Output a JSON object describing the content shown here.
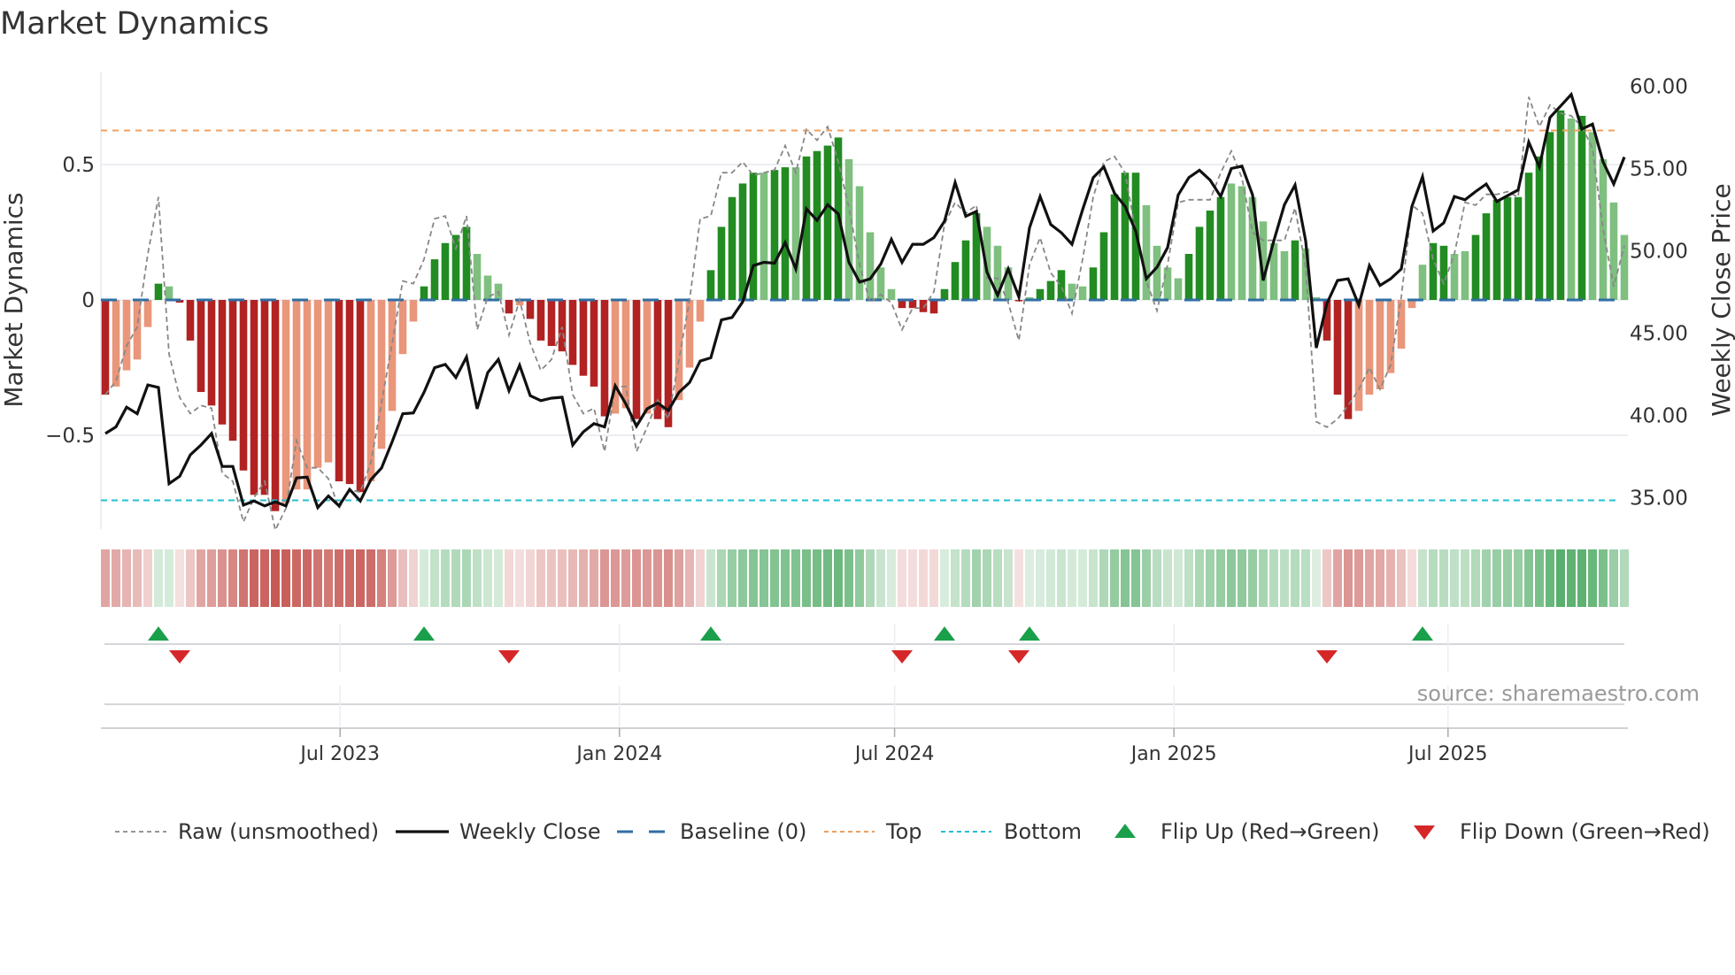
{
  "chart_data": {
    "type": "bar",
    "title": "Market Dynamics",
    "ylabel": "Market Dynamics",
    "y2label": "Weekly Close Price",
    "source": "source: sharemaestro.com",
    "ylim": [
      -0.846,
      0.843
    ],
    "y2lim": [
      33.07,
      60.9
    ],
    "left_ticks": [
      {
        "value": 0.5,
        "label": "0.5"
      },
      {
        "value": 0,
        "label": "0"
      },
      {
        "value": -0.5,
        "label": "−0.5"
      }
    ],
    "right_ticks": [
      {
        "value": 60,
        "label": "60.00"
      },
      {
        "value": 55,
        "label": "55.00"
      },
      {
        "value": 50,
        "label": "50.00"
      },
      {
        "value": 45,
        "label": "45.00"
      },
      {
        "value": 40,
        "label": "40.00"
      },
      {
        "value": 35,
        "label": "35.00"
      }
    ],
    "x_ticks": [
      {
        "week": 22.1,
        "label": "Jul 2023"
      },
      {
        "week": 48.4,
        "label": "Jan 2024"
      },
      {
        "week": 74.3,
        "label": "Jul 2024"
      },
      {
        "week": 100.6,
        "label": "Jan 2025"
      },
      {
        "week": 126.4,
        "label": "Jul 2025"
      }
    ],
    "levels": {
      "baseline": 0,
      "top": 0.626,
      "bottom": -0.74
    },
    "colors": {
      "strong_green": "#228b22",
      "weak_green": "#7fbf7f",
      "strong_red": "#b22222",
      "weak_red": "#e9967a",
      "close": "#111111",
      "raw": "#888888",
      "baseline": "#2f6fa3",
      "top": "#f0a060",
      "bottom": "#22c0d0",
      "flip_up": "#1a9f4a",
      "flip_down": "#d62728",
      "heat_green": "#4aa860",
      "heat_red": "#c75a55"
    },
    "smoothed": [
      -0.35,
      -0.32,
      -0.26,
      -0.22,
      -0.1,
      0.06,
      0.05,
      -0.01,
      -0.15,
      -0.34,
      -0.39,
      -0.46,
      -0.52,
      -0.63,
      -0.72,
      -0.72,
      -0.78,
      -0.75,
      -0.7,
      -0.7,
      -0.62,
      -0.6,
      -0.67,
      -0.68,
      -0.71,
      -0.67,
      -0.55,
      -0.41,
      -0.2,
      -0.08,
      0.05,
      0.15,
      0.21,
      0.24,
      0.27,
      0.17,
      0.09,
      0.06,
      -0.05,
      -0.02,
      -0.07,
      -0.15,
      -0.17,
      -0.19,
      -0.24,
      -0.28,
      -0.32,
      -0.43,
      -0.42,
      -0.4,
      -0.44,
      -0.42,
      -0.44,
      -0.47,
      -0.37,
      -0.25,
      -0.08,
      0.11,
      0.27,
      0.38,
      0.43,
      0.47,
      0.47,
      0.48,
      0.49,
      0.49,
      0.53,
      0.55,
      0.57,
      0.6,
      0.52,
      0.42,
      0.25,
      0.12,
      0.04,
      -0.03,
      -0.03,
      -0.045,
      -0.05,
      0.04,
      0.14,
      0.22,
      0.32,
      0.27,
      0.2,
      0.12,
      -0.005,
      0.01,
      0.04,
      0.07,
      0.11,
      0.06,
      0.05,
      0.12,
      0.25,
      0.39,
      0.47,
      0.47,
      0.35,
      0.2,
      0.12,
      0.08,
      0.17,
      0.27,
      0.33,
      0.38,
      0.43,
      0.42,
      0.38,
      0.29,
      0.21,
      0.18,
      0.22,
      0.19,
      0.01,
      -0.15,
      -0.35,
      -0.44,
      -0.41,
      -0.35,
      -0.33,
      -0.27,
      -0.18,
      -0.03,
      0.13,
      0.21,
      0.2,
      0.17,
      0.18,
      0.24,
      0.32,
      0.37,
      0.38,
      0.38,
      0.47,
      0.53,
      0.62,
      0.7,
      0.67,
      0.68,
      0.62,
      0.52,
      0.36,
      0.24
    ],
    "shade": "DLLLLDLDDDDDDDDDDLLLLLDDDLLLLLDDDDDLLLDLDDDDDDDDLLDLDDLLLDDDDDLDDLDDDDLLLLLDDDDDDDDLLLDLDDDLLDDDDDLLLLDDDDLLLLLLDLLDDDLLLLLLLDDLLDDDDDDDDDLDLLLL",
    "raw": [
      -0.35,
      -0.3,
      -0.17,
      -0.1,
      0.17,
      0.38,
      -0.2,
      -0.36,
      -0.42,
      -0.39,
      -0.4,
      -0.64,
      -0.67,
      -0.82,
      -0.73,
      -0.67,
      -0.85,
      -0.77,
      -0.52,
      -0.62,
      -0.62,
      -0.66,
      -0.77,
      -0.7,
      -0.71,
      -0.6,
      -0.38,
      -0.16,
      0.07,
      0.06,
      0.15,
      0.3,
      0.31,
      0.19,
      0.31,
      -0.11,
      0.01,
      0.03,
      -0.13,
      0.0,
      -0.16,
      -0.26,
      -0.22,
      -0.1,
      -0.35,
      -0.42,
      -0.4,
      -0.56,
      -0.32,
      -0.32,
      -0.56,
      -0.47,
      -0.37,
      -0.44,
      -0.22,
      0.0,
      0.3,
      0.31,
      0.47,
      0.47,
      0.51,
      0.46,
      0.47,
      0.48,
      0.57,
      0.47,
      0.63,
      0.59,
      0.64,
      0.51,
      0.34,
      0.13,
      -0.01,
      0.02,
      -0.01,
      -0.11,
      -0.03,
      -0.03,
      0.03,
      0.28,
      0.36,
      0.32,
      0.35,
      0.08,
      0.08,
      -0.01,
      -0.15,
      0.13,
      0.23,
      0.1,
      0.05,
      -0.05,
      0.15,
      0.38,
      0.51,
      0.53,
      0.47,
      0.25,
      0.07,
      -0.04,
      0.13,
      0.36,
      0.37,
      0.37,
      0.37,
      0.47,
      0.55,
      0.45,
      0.25,
      0.22,
      0.22,
      0.22,
      0.34,
      0.12,
      -0.45,
      -0.47,
      -0.44,
      -0.39,
      -0.33,
      -0.25,
      -0.33,
      -0.24,
      0.01,
      0.35,
      0.32,
      0.15,
      0.06,
      0.17,
      0.36,
      0.35,
      0.39,
      0.39,
      0.4,
      0.38,
      0.75,
      0.64,
      0.72,
      0.69,
      0.68,
      0.64,
      0.56,
      0.26,
      0.05,
      0.2
    ],
    "close": [
      38.9,
      39.3,
      40.5,
      40.1,
      41.85,
      41.7,
      35.85,
      36.3,
      37.6,
      38.2,
      38.9,
      36.9,
      36.9,
      34.55,
      34.8,
      34.5,
      34.75,
      34.5,
      36.2,
      36.25,
      34.4,
      35.1,
      34.5,
      35.5,
      34.8,
      36.1,
      36.8,
      38.4,
      40.1,
      40.15,
      41.4,
      42.9,
      43.1,
      42.3,
      43.55,
      40.4,
      42.6,
      43.4,
      41.5,
      43.05,
      41.2,
      40.9,
      41.05,
      41.1,
      38.2,
      39.0,
      39.5,
      39.3,
      41.8,
      40.7,
      39.35,
      40.4,
      40.75,
      40.3,
      41.4,
      42.0,
      43.3,
      43.5,
      45.8,
      45.95,
      46.9,
      49.1,
      49.3,
      49.25,
      50.5,
      48.9,
      52.55,
      51.85,
      52.8,
      52.25,
      49.3,
      48.1,
      48.3,
      49.2,
      50.7,
      49.3,
      50.4,
      50.4,
      50.8,
      51.8,
      54.15,
      52.1,
      52.4,
      48.7,
      47.3,
      48.9,
      47.2,
      51.4,
      53.3,
      51.6,
      51.1,
      50.4,
      52.5,
      54.45,
      55.1,
      53.5,
      52.7,
      51.2,
      48.3,
      49.0,
      50.2,
      53.4,
      54.45,
      54.9,
      54.3,
      53.3,
      55.0,
      55.15,
      53.4,
      48.2,
      50.6,
      52.8,
      54.0,
      50.6,
      44.1,
      46.8,
      48.2,
      48.3,
      46.7,
      49.1,
      47.9,
      48.3,
      48.9,
      52.7,
      54.5,
      51.2,
      51.7,
      53.3,
      53.1,
      53.6,
      54.06,
      53.0,
      53.35,
      53.7,
      56.6,
      55.1,
      58.1,
      58.8,
      59.5,
      57.4,
      57.7,
      55.4,
      54.06,
      55.7
    ],
    "flip_up_weeks": [
      5,
      30,
      57,
      79,
      87,
      124
    ],
    "flip_down_weeks": [
      7,
      38,
      75,
      86,
      115
    ],
    "legend": [
      {
        "key": "raw",
        "label": "Raw (unsmoothed)"
      },
      {
        "key": "close",
        "label": "Weekly Close"
      },
      {
        "key": "baseline",
        "label": "Baseline (0)"
      },
      {
        "key": "top",
        "label": "Top"
      },
      {
        "key": "bottom",
        "label": "Bottom"
      },
      {
        "key": "flip_up",
        "label": "Flip Up (Red→Green)"
      },
      {
        "key": "flip_down",
        "label": "Flip Down (Green→Red)"
      }
    ]
  }
}
